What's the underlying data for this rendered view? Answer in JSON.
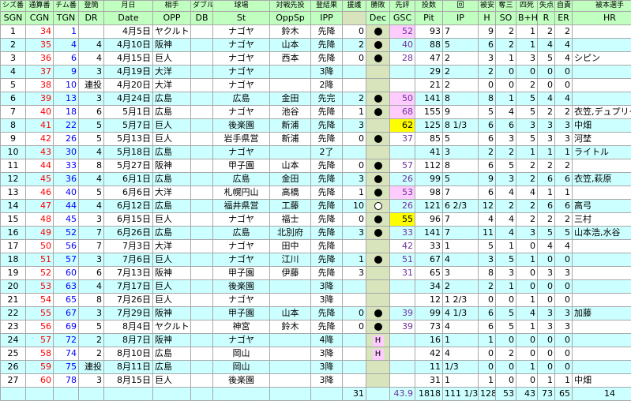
{
  "header_top": [
    "シズ番",
    "通算番",
    "チム番",
    "登簡",
    "月日",
    "相手",
    "ダブル",
    "球場",
    "対戦先投",
    "登結果",
    "援護",
    "勝敗",
    "先評",
    "投数",
    "回",
    "被安",
    "奪三",
    "四死",
    "失点",
    "自責",
    "被本選手"
  ],
  "header_bottom": [
    "SGN",
    "CGN",
    "TGN",
    "DR",
    "Date",
    "OPP",
    "DB",
    "St",
    "OppSp",
    "IPP",
    "",
    "Dec",
    "GSC",
    "Pit",
    "IP",
    "H",
    "SO",
    "B+H",
    "R",
    "ER",
    "HR"
  ],
  "rows": [
    {
      "sgn": "1",
      "cgn": "34",
      "tgn": "1",
      "dr": "",
      "date": "4月5日",
      "opp": "ヤクルト",
      "db": "",
      "st": "ナゴヤ",
      "oppsp": "鈴木",
      "ipp": "先降",
      "run": "0",
      "dec": "black",
      "gsc": "52",
      "gsc_style": "pink",
      "pit": "93",
      "ip": "7",
      "h": "9",
      "so": "2",
      "bh": "1",
      "r": "2",
      "er": "2",
      "hr": ""
    },
    {
      "sgn": "2",
      "cgn": "35",
      "tgn": "4",
      "dr": "4",
      "date": "4月10日",
      "opp": "阪神",
      "db": "",
      "st": "ナゴヤ",
      "oppsp": "山本",
      "ipp": "先降",
      "run": "2",
      "dec": "black",
      "gsc": "40",
      "gsc_style": "",
      "pit": "88",
      "ip": "5",
      "h": "6",
      "so": "2",
      "bh": "1",
      "r": "4",
      "er": "4",
      "hr": ""
    },
    {
      "sgn": "3",
      "cgn": "36",
      "tgn": "6",
      "dr": "4",
      "date": "4月15日",
      "opp": "巨人",
      "db": "",
      "st": "ナゴヤ",
      "oppsp": "西本",
      "ipp": "先降",
      "run": "0",
      "dec": "black",
      "gsc": "28",
      "gsc_style": "",
      "pit": "47",
      "ip": "2",
      "h": "3",
      "so": "1",
      "bh": "3",
      "r": "5",
      "er": "4",
      "hr": "シピン"
    },
    {
      "sgn": "4",
      "cgn": "37",
      "tgn": "9",
      "dr": "3",
      "date": "4月19日",
      "opp": "大洋",
      "db": "",
      "st": "ナゴヤ",
      "oppsp": "",
      "ipp": "3降",
      "run": "",
      "dec": "",
      "gsc": "",
      "gsc_style": "",
      "pit": "29",
      "ip": "2",
      "h": "2",
      "so": "0",
      "bh": "0",
      "r": "0",
      "er": "0",
      "hr": ""
    },
    {
      "sgn": "5",
      "cgn": "38",
      "tgn": "10",
      "dr": "連投",
      "date": "4月20日",
      "opp": "大洋",
      "db": "",
      "st": "ナゴヤ",
      "oppsp": "",
      "ipp": "2降",
      "run": "",
      "dec": "",
      "gsc": "",
      "gsc_style": "",
      "pit": "21",
      "ip": "2",
      "h": "0",
      "so": "0",
      "bh": "2",
      "r": "0",
      "er": "0",
      "hr": ""
    },
    {
      "sgn": "6",
      "cgn": "39",
      "tgn": "13",
      "dr": "3",
      "date": "4月24日",
      "opp": "広島",
      "db": "",
      "st": "広島",
      "oppsp": "金田",
      "ipp": "先完",
      "run": "2",
      "dec": "black",
      "gsc": "50",
      "gsc_style": "pink",
      "pit": "141",
      "ip": "8",
      "h": "8",
      "so": "1",
      "bh": "5",
      "r": "4",
      "er": "4",
      "hr": ""
    },
    {
      "sgn": "7",
      "cgn": "40",
      "tgn": "18",
      "dr": "6",
      "date": "5月1日",
      "opp": "広島",
      "db": "",
      "st": "ナゴヤ",
      "oppsp": "池谷",
      "ipp": "先降",
      "run": "1",
      "dec": "black",
      "gsc": "68",
      "gsc_style": "pink",
      "pit": "155",
      "ip": "9",
      "h": "5",
      "so": "4",
      "bh": "5",
      "r": "2",
      "er": "2",
      "hr": "衣笠,デュプリー"
    },
    {
      "sgn": "8",
      "cgn": "41",
      "tgn": "22",
      "dr": "5",
      "date": "5月7日",
      "opp": "巨人",
      "db": "",
      "st": "後楽園",
      "oppsp": "新浦",
      "ipp": "先降",
      "run": "3",
      "dec": "purple",
      "gsc": "62",
      "gsc_style": "yellow",
      "pit": "125",
      "ip": "8 1/3",
      "h": "6",
      "so": "6",
      "bh": "3",
      "r": "3",
      "er": "3",
      "hr": "中畑"
    },
    {
      "sgn": "9",
      "cgn": "42",
      "tgn": "26",
      "dr": "5",
      "date": "5月13日",
      "opp": "巨人",
      "db": "",
      "st": "岩手県営",
      "oppsp": "新浦",
      "ipp": "先降",
      "run": "0",
      "dec": "black",
      "gsc": "37",
      "gsc_style": "",
      "pit": "85",
      "ip": "5",
      "h": "6",
      "so": "3",
      "bh": "5",
      "r": "3",
      "er": "3",
      "hr": "河埜"
    },
    {
      "sgn": "10",
      "cgn": "43",
      "tgn": "30",
      "dr": "4",
      "date": "5月18日",
      "opp": "広島",
      "db": "",
      "st": "ナゴヤ",
      "oppsp": "",
      "ipp": "2了",
      "run": "",
      "dec": "",
      "gsc": "",
      "gsc_style": "",
      "pit": "41",
      "ip": "3",
      "h": "2",
      "so": "2",
      "bh": "1",
      "r": "1",
      "er": "1",
      "hr": "ライトル"
    },
    {
      "sgn": "11",
      "cgn": "44",
      "tgn": "33",
      "dr": "8",
      "date": "5月27日",
      "opp": "阪神",
      "db": "",
      "st": "甲子園",
      "oppsp": "山本",
      "ipp": "先降",
      "run": "0",
      "dec": "black",
      "gsc": "57",
      "gsc_style": "",
      "pit": "112",
      "ip": "8",
      "h": "6",
      "so": "5",
      "bh": "2",
      "r": "2",
      "er": "2",
      "hr": ""
    },
    {
      "sgn": "12",
      "cgn": "45",
      "tgn": "36",
      "dr": "4",
      "date": "6月1日",
      "opp": "広島",
      "db": "",
      "st": "広島",
      "oppsp": "金田",
      "ipp": "先降",
      "run": "3",
      "dec": "black",
      "gsc": "26",
      "gsc_style": "",
      "pit": "99",
      "ip": "5",
      "h": "9",
      "so": "3",
      "bh": "2",
      "r": "6",
      "er": "6",
      "hr": "衣笠,萩原"
    },
    {
      "sgn": "13",
      "cgn": "46",
      "tgn": "40",
      "dr": "5",
      "date": "6月6日",
      "opp": "大洋",
      "db": "",
      "st": "札幌円山",
      "oppsp": "高橋",
      "ipp": "先降",
      "run": "1",
      "dec": "black",
      "gsc": "53",
      "gsc_style": "pink",
      "pit": "98",
      "ip": "7",
      "h": "6",
      "so": "4",
      "bh": "4",
      "r": "1",
      "er": "1",
      "hr": ""
    },
    {
      "sgn": "14",
      "cgn": "47",
      "tgn": "44",
      "dr": "4",
      "date": "6月12日",
      "opp": "広島",
      "db": "",
      "st": "福井県営",
      "oppsp": "工藤",
      "ipp": "先降",
      "run": "10",
      "dec": "white",
      "gsc": "26",
      "gsc_style": "",
      "pit": "121",
      "ip": "6 2/3",
      "h": "12",
      "so": "2",
      "bh": "2",
      "r": "6",
      "er": "6",
      "hr": "高弓"
    },
    {
      "sgn": "15",
      "cgn": "48",
      "tgn": "45",
      "dr": "3",
      "date": "6月15日",
      "opp": "巨人",
      "db": "",
      "st": "ナゴヤ",
      "oppsp": "福士",
      "ipp": "先降",
      "run": "0",
      "dec": "black",
      "gsc": "55",
      "gsc_style": "yellow",
      "pit": "96",
      "ip": "7",
      "h": "4",
      "so": "4",
      "bh": "2",
      "r": "2",
      "er": "2",
      "hr": "三村"
    },
    {
      "sgn": "16",
      "cgn": "49",
      "tgn": "52",
      "dr": "7",
      "date": "6月26日",
      "opp": "広島",
      "db": "",
      "st": "広島",
      "oppsp": "北別府",
      "ipp": "先降",
      "run": "3",
      "dec": "black",
      "gsc": "33",
      "gsc_style": "",
      "pit": "141",
      "ip": "7",
      "h": "11",
      "so": "4",
      "bh": "3",
      "r": "5",
      "er": "5",
      "hr": "山本浩,水谷"
    },
    {
      "sgn": "17",
      "cgn": "50",
      "tgn": "56",
      "dr": "7",
      "date": "7月3日",
      "opp": "大洋",
      "db": "",
      "st": "ナゴヤ",
      "oppsp": "田中",
      "ipp": "先降",
      "run": "",
      "dec": "",
      "gsc": "42",
      "gsc_style": "",
      "pit": "33",
      "ip": "1",
      "h": "5",
      "so": "1",
      "bh": "0",
      "r": "4",
      "er": "4",
      "hr": ""
    },
    {
      "sgn": "18",
      "cgn": "51",
      "tgn": "57",
      "dr": "3",
      "date": "7月6日",
      "opp": "巨人",
      "db": "",
      "st": "ナゴヤ",
      "oppsp": "江川",
      "ipp": "先降",
      "run": "1",
      "dec": "black",
      "gsc": "51",
      "gsc_style": "",
      "pit": "67",
      "ip": "4",
      "h": "3",
      "so": "5",
      "bh": "1",
      "r": "0",
      "er": "0",
      "hr": ""
    },
    {
      "sgn": "19",
      "cgn": "52",
      "tgn": "60",
      "dr": "6",
      "date": "7月13日",
      "opp": "阪神",
      "db": "",
      "st": "甲子園",
      "oppsp": "伊藤",
      "ipp": "先降",
      "run": "3",
      "dec": "pinkbox",
      "gsc": "31",
      "gsc_style": "",
      "pit": "65",
      "ip": "3",
      "h": "8",
      "so": "3",
      "bh": "0",
      "r": "3",
      "er": "3",
      "hr": ""
    },
    {
      "sgn": "20",
      "cgn": "53",
      "tgn": "63",
      "dr": "4",
      "date": "7月17日",
      "opp": "巨人",
      "db": "",
      "st": "後楽園",
      "oppsp": "",
      "ipp": "3降",
      "run": "",
      "dec": "",
      "gsc": "",
      "gsc_style": "",
      "pit": "34",
      "ip": "2",
      "h": "2",
      "so": "1",
      "bh": "0",
      "r": "0",
      "er": "0",
      "hr": ""
    },
    {
      "sgn": "21",
      "cgn": "54",
      "tgn": "65",
      "dr": "8",
      "date": "7月26日",
      "opp": "巨人",
      "db": "",
      "st": "ナゴヤ",
      "oppsp": "",
      "ipp": "3降",
      "run": "",
      "dec": "",
      "gsc": "",
      "gsc_style": "",
      "pit": "12",
      "ip": "1 2/3",
      "h": "0",
      "so": "0",
      "bh": "1",
      "r": "0",
      "er": "0",
      "hr": ""
    },
    {
      "sgn": "22",
      "cgn": "55",
      "tgn": "67",
      "dr": "3",
      "date": "7月29日",
      "opp": "阪神",
      "db": "",
      "st": "甲子園",
      "oppsp": "山本",
      "ipp": "先降",
      "run": "0",
      "dec": "black",
      "gsc": "39",
      "gsc_style": "",
      "pit": "99",
      "ip": "4 1/3",
      "h": "6",
      "so": "5",
      "bh": "4",
      "r": "3",
      "er": "3",
      "hr": "加藤"
    },
    {
      "sgn": "23",
      "cgn": "56",
      "tgn": "69",
      "dr": "5",
      "date": "8月4日",
      "opp": "ヤクルト",
      "db": "",
      "st": "神宮",
      "oppsp": "鈴木",
      "ipp": "先降",
      "run": "0",
      "dec": "black",
      "gsc": "39",
      "gsc_style": "",
      "pit": "73",
      "ip": "4",
      "h": "6",
      "so": "5",
      "bh": "1",
      "r": "3",
      "er": "3",
      "hr": ""
    },
    {
      "sgn": "24",
      "cgn": "57",
      "tgn": "72",
      "dr": "2",
      "date": "8月7日",
      "opp": "阪神",
      "db": "",
      "st": "ナゴヤ",
      "oppsp": "",
      "ipp": "4降",
      "run": "",
      "dec": "H",
      "gsc": "",
      "gsc_style": "",
      "pit": "16",
      "ip": "1",
      "h": "1",
      "so": "0",
      "bh": "0",
      "r": "0",
      "er": "0",
      "hr": ""
    },
    {
      "sgn": "25",
      "cgn": "58",
      "tgn": "74",
      "dr": "2",
      "date": "8月10日",
      "opp": "広島",
      "db": "",
      "st": "岡山",
      "oppsp": "",
      "ipp": "3降",
      "run": "",
      "dec": "H",
      "gsc": "",
      "gsc_style": "",
      "pit": "42",
      "ip": "4",
      "h": "0",
      "so": "2",
      "bh": "0",
      "r": "0",
      "er": "0",
      "hr": ""
    },
    {
      "sgn": "26",
      "cgn": "59",
      "tgn": "75",
      "dr": "連投",
      "date": "8月11日",
      "opp": "広島",
      "db": "",
      "st": "岡山",
      "oppsp": "",
      "ipp": "3降",
      "run": "",
      "dec": "",
      "gsc": "",
      "gsc_style": "",
      "pit": "11",
      "ip": "1/3",
      "h": "0",
      "so": "0",
      "bh": "1",
      "r": "0",
      "er": "0",
      "hr": ""
    },
    {
      "sgn": "27",
      "cgn": "60",
      "tgn": "78",
      "dr": "3",
      "date": "8月15日",
      "opp": "巨人",
      "db": "",
      "st": "後楽園",
      "oppsp": "",
      "ipp": "3降",
      "run": "",
      "dec": "",
      "gsc": "",
      "gsc_style": "",
      "pit": "31",
      "ip": "1",
      "h": "1",
      "so": "0",
      "bh": "0",
      "r": "1",
      "er": "1",
      "hr": "中畑"
    }
  ],
  "totals": {
    "run": "31",
    "gsc": "43.9",
    "pit": "1818",
    "ip": "111 1/3",
    "h": "128",
    "so": "53",
    "bh": "43",
    "r": "73",
    "er": "65",
    "hr": "14"
  }
}
